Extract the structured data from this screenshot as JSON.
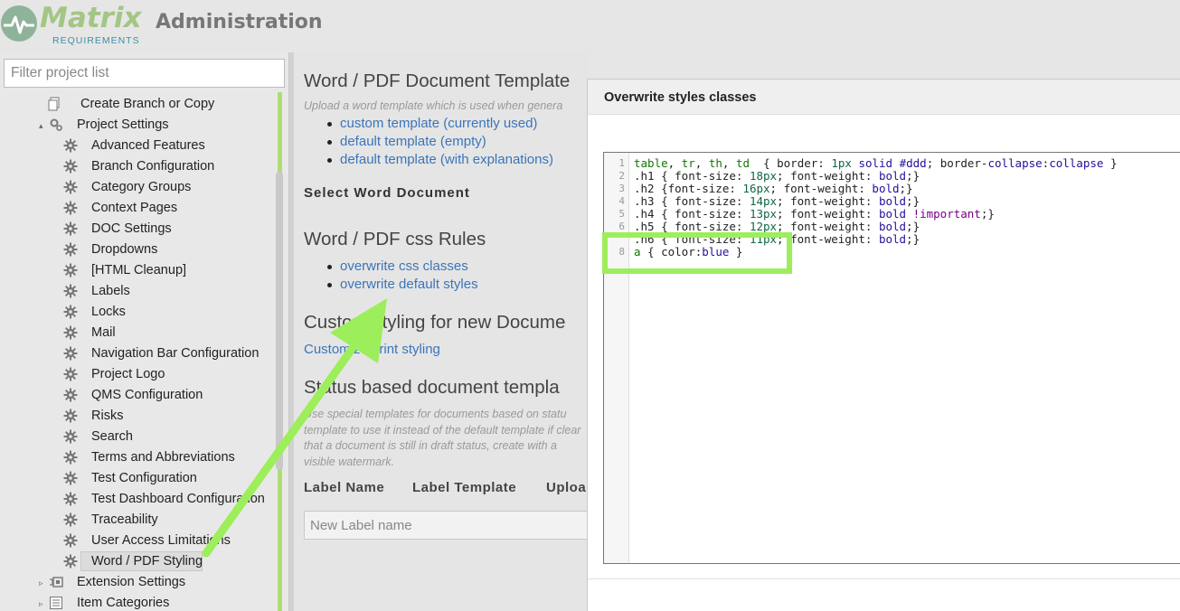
{
  "header": {
    "brand": "Matrix",
    "brand_sub": "REQUIREMENTS",
    "title": "Administration"
  },
  "sidebar": {
    "filter_placeholder": "Filter project list",
    "items": [
      {
        "label": "Create Branch or Copy",
        "icon": "copy-icon"
      },
      {
        "label": "Project Settings",
        "icon": "settings-icon",
        "toggle": "▴"
      },
      {
        "label": "Advanced Features",
        "icon": "gear-icon"
      },
      {
        "label": "Branch Configuration",
        "icon": "gear-icon"
      },
      {
        "label": "Category Groups",
        "icon": "gear-icon"
      },
      {
        "label": "Context Pages",
        "icon": "gear-icon"
      },
      {
        "label": "DOC Settings",
        "icon": "gear-icon"
      },
      {
        "label": "Dropdowns",
        "icon": "gear-icon"
      },
      {
        "label": "[HTML Cleanup]",
        "icon": "gear-icon"
      },
      {
        "label": "Labels",
        "icon": "gear-icon"
      },
      {
        "label": "Locks",
        "icon": "gear-icon"
      },
      {
        "label": "Mail",
        "icon": "gear-icon"
      },
      {
        "label": "Navigation Bar Configuration",
        "icon": "gear-icon"
      },
      {
        "label": "Project Logo",
        "icon": "gear-icon"
      },
      {
        "label": "QMS Configuration",
        "icon": "gear-icon"
      },
      {
        "label": "Risks",
        "icon": "gear-icon"
      },
      {
        "label": "Search",
        "icon": "gear-icon"
      },
      {
        "label": "Terms and Abbreviations",
        "icon": "gear-icon"
      },
      {
        "label": "Test Configuration",
        "icon": "gear-icon"
      },
      {
        "label": "Test Dashboard Configuration",
        "icon": "gear-icon"
      },
      {
        "label": "Traceability",
        "icon": "gear-icon"
      },
      {
        "label": "User Access Limitations",
        "icon": "gear-icon"
      },
      {
        "label": "Word / PDF Styling",
        "icon": "gear-icon",
        "selected": true
      },
      {
        "label": "Extension Settings",
        "icon": "extension-icon",
        "toggle": "▹"
      },
      {
        "label": "Item Categories",
        "icon": "list-icon",
        "toggle": "▹"
      }
    ]
  },
  "main": {
    "title": "Word / PDF Document Template",
    "subtitle": "Upload a word template which is used when genera",
    "template_links": [
      "custom template (currently used)",
      "default template (empty)",
      "default template (with explanations)"
    ],
    "select_word": "Select Word Document",
    "css_title": "Word / PDF css Rules",
    "css_links": [
      "overwrite css classes",
      "overwrite default styles"
    ],
    "custom_title": "Custom styling for new Docume",
    "custom_link": "Customize print styling",
    "status_title": "Status based document templa",
    "status_text": "Use special templates for documents based on statu template to use it instead of the default template if clear that a document is still in draft status, create with a visible watermark.",
    "table_headers": [
      "Label Name",
      "Label Template",
      "Uploa"
    ],
    "new_label_placeholder": "New Label name"
  },
  "dialog": {
    "title": "Overwrite styles classes",
    "line_numbers": [
      "1",
      "2",
      "3",
      "4",
      "5",
      "6",
      "8"
    ],
    "code_lines": [
      "table, tr, th, td  { border: 1px solid #ddd; border-collapse:collapse }",
      ".h1 { font-size: 18px; font-weight: bold;}",
      ".h2 {font-size: 16px; font-weight: bold;}",
      ".h3 { font-size: 14px; font-weight: bold;}",
      ".h4 { font-size: 13px; font-weight: bold !important;}",
      ".h5 { font-size: 12px; font-weight: bold;}",
      ".h6 { font-size: 11px; font-weight: bold;}",
      "a { color:blue }"
    ]
  },
  "colors": {
    "highlight": "#9dee5b",
    "link": "#3a75b9",
    "brand_green": "#a3c684"
  }
}
